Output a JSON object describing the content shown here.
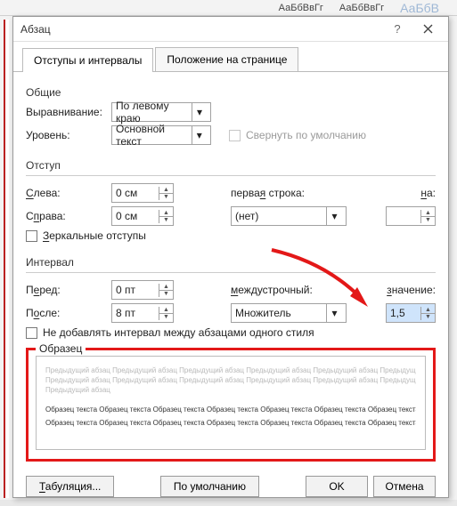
{
  "ribbon": {
    "style1": "АаБбВвГг",
    "style2": "АаБбВвГг",
    "style3": "АаБбВ"
  },
  "dialog": {
    "title": "Абзац",
    "tabs": {
      "spacing": "Отступы и интервалы",
      "position": "Положение на странице"
    },
    "general": {
      "title": "Общие",
      "alignment_label": "Выравнивание:",
      "alignment_value": "По левому краю",
      "level_label": "Уровень:",
      "level_value": "Основной текст",
      "collapse_label": "Свернуть по умолчанию"
    },
    "indent": {
      "title": "Отступ",
      "left_label": "Слева:",
      "left_value": "0 см",
      "right_label": "Справа:",
      "right_value": "0 см",
      "first_line_label": "первая строка:",
      "first_line_value": "(нет)",
      "by_label": "на:",
      "by_value": "",
      "mirror_label": "Зеркальные отступы"
    },
    "spacing": {
      "title": "Интервал",
      "before_label": "Перед:",
      "before_value": "0 пт",
      "after_label": "После:",
      "after_value": "8 пт",
      "line_label": "междустрочный:",
      "line_value": "Множитель",
      "value_label": "значение:",
      "value_value": "1,5",
      "nospace_label": "Не добавлять интервал между абзацами одного стиля"
    },
    "preview": {
      "title": "Образец",
      "prev_word": "Предыдущий абзац",
      "sample_word": "Образец текста"
    },
    "buttons": {
      "tabs": "Табуляция...",
      "default": "По умолчанию",
      "ok": "OK",
      "cancel": "Отмена"
    }
  }
}
